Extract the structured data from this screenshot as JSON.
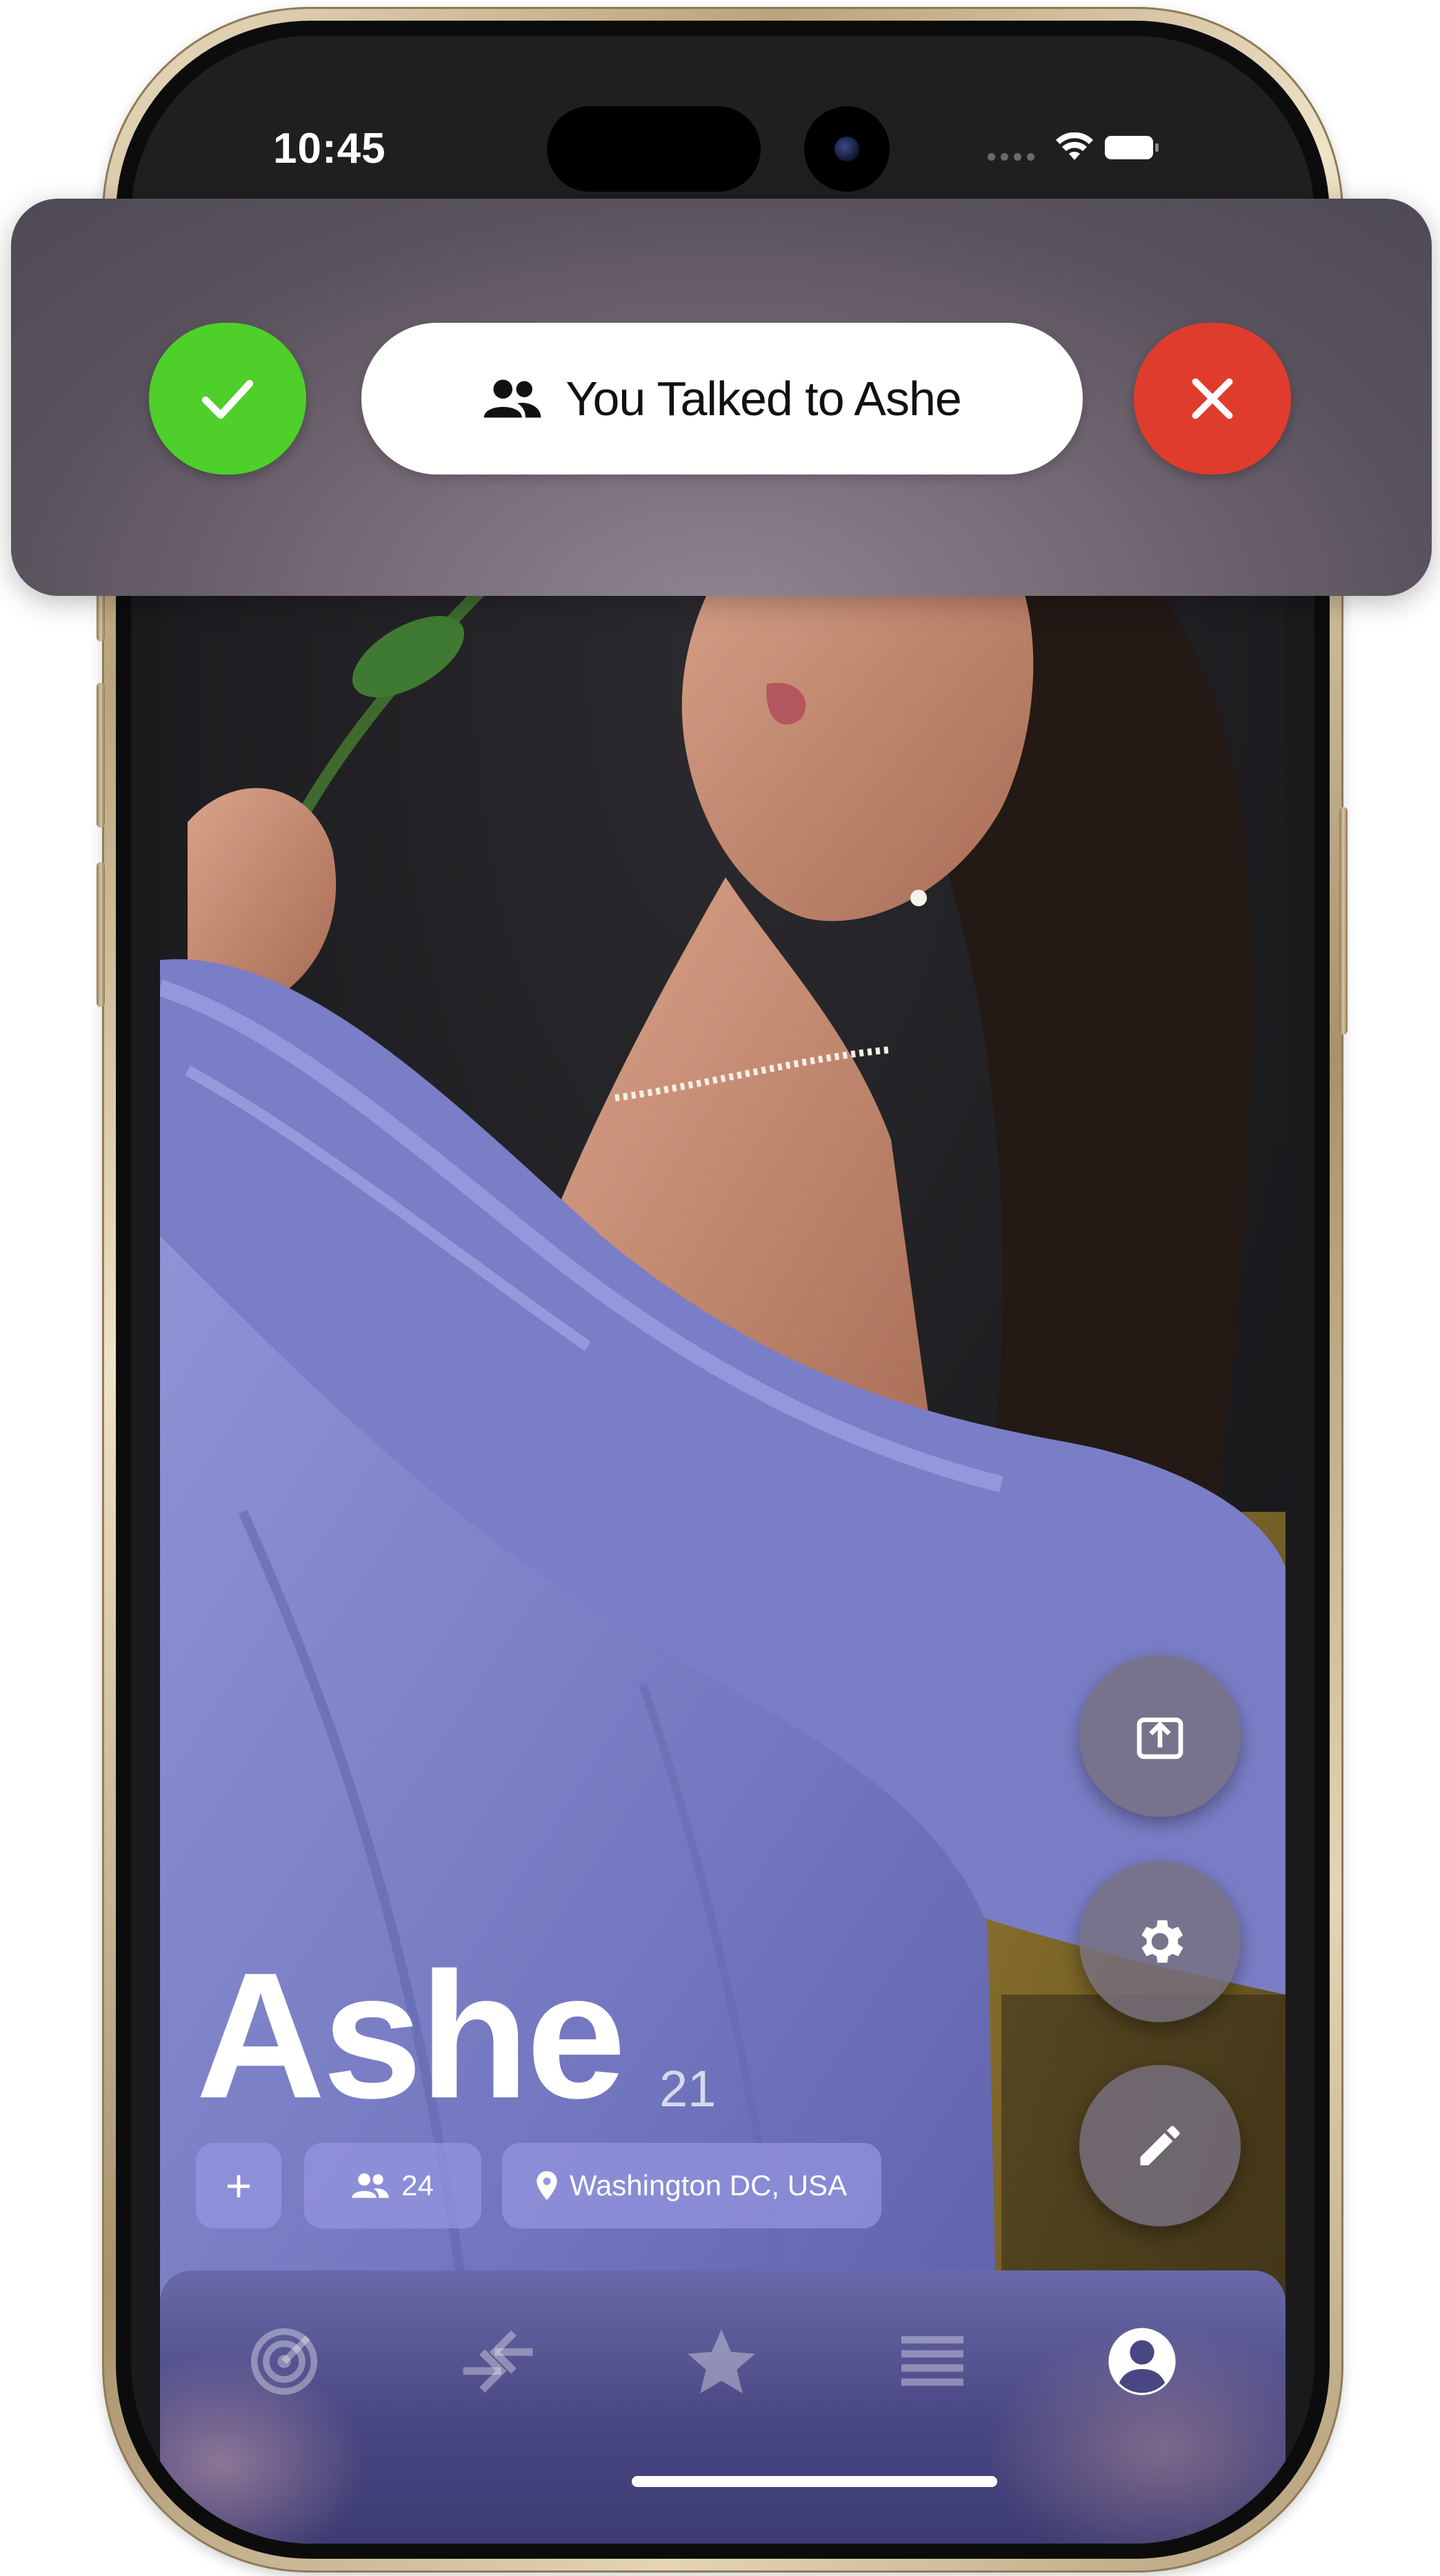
{
  "status_bar": {
    "time": "10:45"
  },
  "banner": {
    "message": "You Talked to Ashe",
    "accept_icon": "checkmark-icon",
    "decline_icon": "close-icon",
    "message_icon": "people-icon",
    "accept_color": "#4ecf2a",
    "decline_color": "#e03c2e"
  },
  "profile": {
    "name": "Ashe",
    "age": "21",
    "add_label": "+",
    "friends_count": "24",
    "location": "Washington DC, USA"
  },
  "actions": [
    {
      "name": "share",
      "icon": "share-icon"
    },
    {
      "name": "settings",
      "icon": "gear-icon"
    },
    {
      "name": "edit",
      "icon": "pencil-icon"
    }
  ],
  "tab_bar": {
    "tabs": [
      {
        "name": "radar",
        "icon": "radar-icon",
        "active": false
      },
      {
        "name": "swap",
        "icon": "swap-arrows-icon",
        "active": false
      },
      {
        "name": "favorites",
        "icon": "star-icon",
        "active": false
      },
      {
        "name": "list",
        "icon": "list-icon",
        "active": false
      },
      {
        "name": "profile",
        "icon": "account-circle-icon",
        "active": true
      }
    ]
  },
  "colors": {
    "chip_background": "#9696e1",
    "tab_bar": "#484783"
  }
}
